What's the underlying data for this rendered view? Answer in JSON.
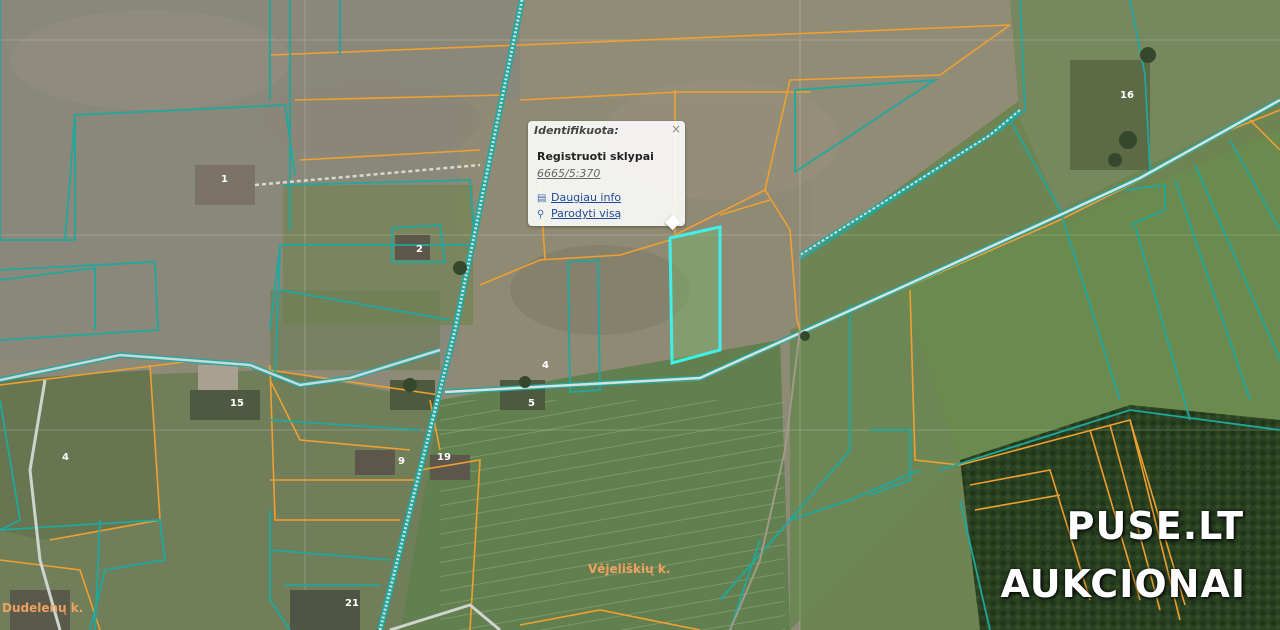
{
  "popup": {
    "header": "Identifikuota:",
    "close": "×",
    "layer_title": "Registruoti sklypai",
    "parcel_id": "6665/5:370",
    "more_info": "Daugiau info",
    "show_all": "Parodyti visą"
  },
  "places": {
    "village_center": "Vėjeliškių k.",
    "village_left": "Dudelenų k."
  },
  "house_numbers": [
    "1",
    "2",
    "4",
    "5",
    "4",
    "15",
    "9",
    "19",
    "21",
    "16"
  ],
  "watermark": {
    "line1": "PUSE.LT",
    "line2": "AUKCIONAI"
  },
  "colors": {
    "parcel_line": "#1fa89e",
    "boundary_line": "#f0a030",
    "selected_parcel": "#40f0e8",
    "road": "#c8d8e0"
  }
}
